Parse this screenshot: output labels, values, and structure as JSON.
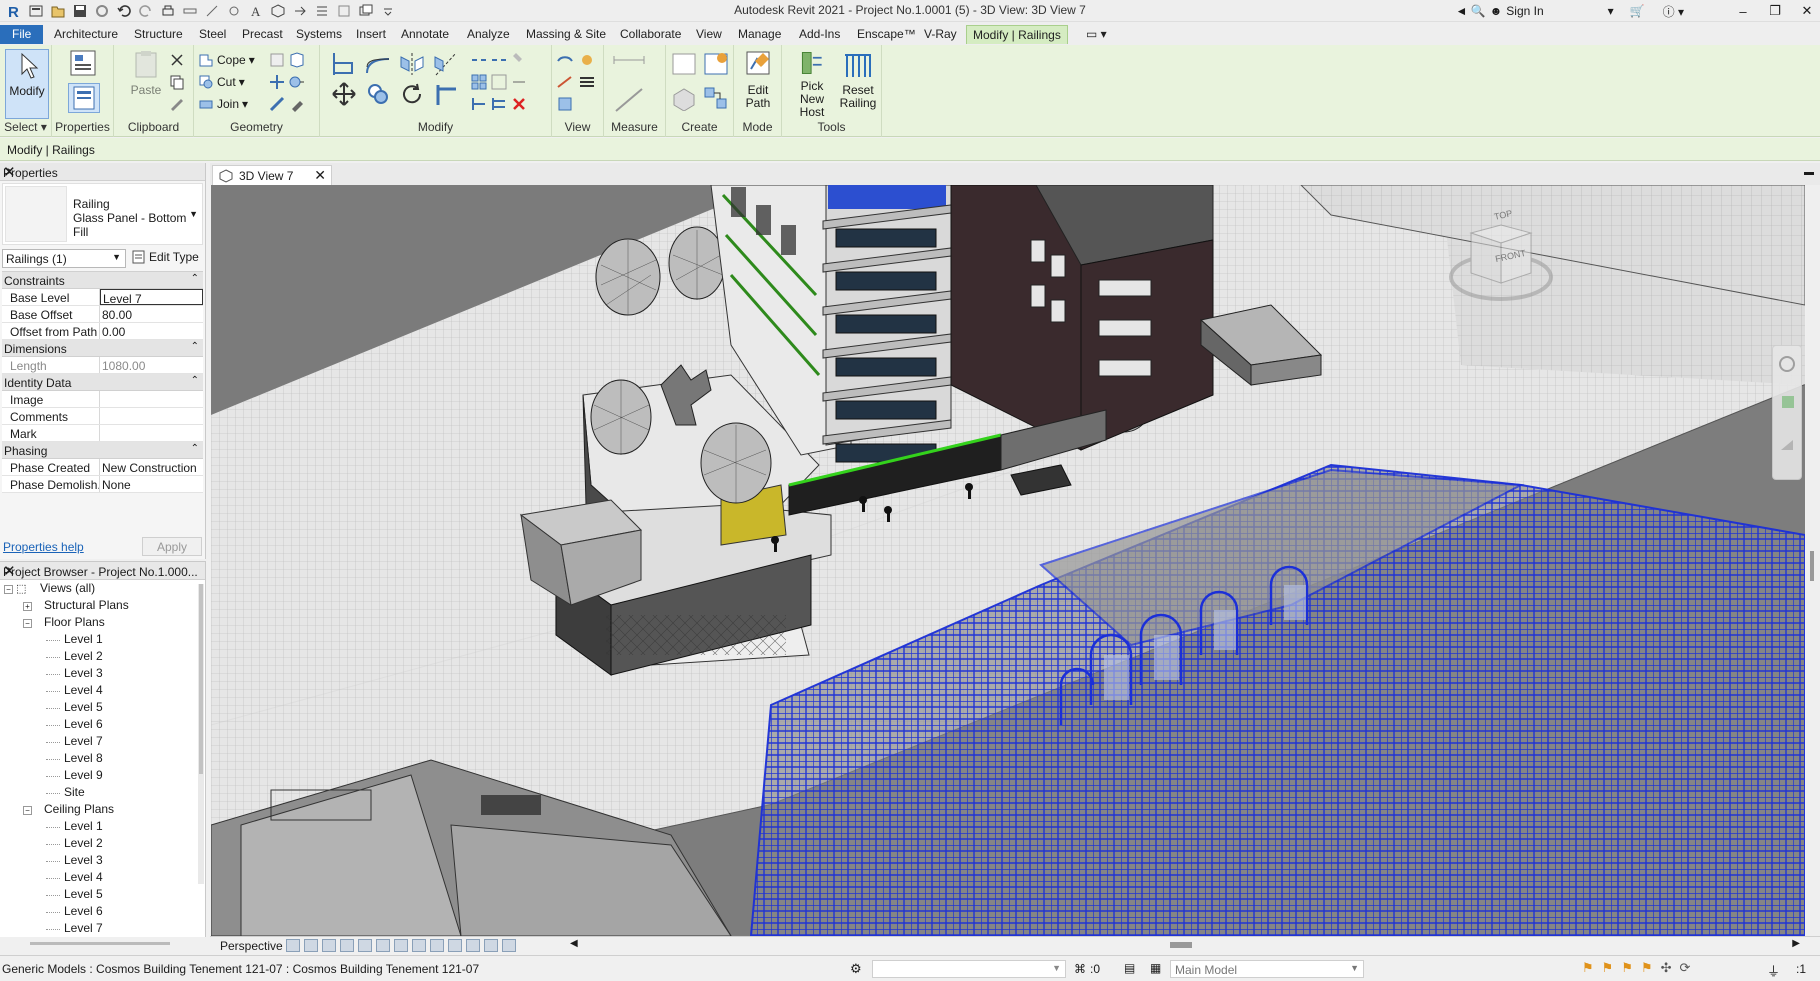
{
  "window": {
    "title": "Autodesk Revit 2021 - Project No.1.0001 (5) - 3D View: 3D View 7",
    "sign_in": "Sign In",
    "minimize": "–",
    "restore": "❐",
    "close": "✕"
  },
  "ribbon_tabs": [
    "File",
    "Architecture",
    "Structure",
    "Steel",
    "Precast",
    "Systems",
    "Insert",
    "Annotate",
    "Analyze",
    "Massing & Site",
    "Collaborate",
    "View",
    "Manage",
    "Add-Ins",
    "Enscape™",
    "V-Ray",
    "Modify | Railings"
  ],
  "ribbon": {
    "select": {
      "modify": "Modify",
      "label": "Select ▾"
    },
    "properties": {
      "label": "Properties"
    },
    "clipboard": {
      "paste": "Paste",
      "label": "Clipboard"
    },
    "geometry": {
      "cope": "Cope",
      "cut": "Cut",
      "join": "Join",
      "label": "Geometry"
    },
    "modify": {
      "label": "Modify"
    },
    "view": {
      "label": "View"
    },
    "measure": {
      "label": "Measure"
    },
    "create": {
      "label": "Create"
    },
    "mode": {
      "edit_path_1": "Edit",
      "edit_path_2": "Path",
      "label": "Mode"
    },
    "tools": {
      "pick_1": "Pick",
      "pick_2": "New Host",
      "reset_1": "Reset",
      "reset_2": "Railing",
      "label": "Tools"
    }
  },
  "context_bar": "Modify | Railings",
  "properties": {
    "header": "Properties",
    "type_family": "Railing",
    "type_name": "Glass Panel - Bottom Fill",
    "instance_selector": "Railings (1)",
    "edit_type": "Edit Type",
    "groups": {
      "constraints": "Constraints",
      "dimensions": "Dimensions",
      "identity": "Identity Data",
      "phasing": "Phasing"
    },
    "rows": {
      "base_level": {
        "name": "Base Level",
        "value": "Level 7"
      },
      "base_offset": {
        "name": "Base Offset",
        "value": "80.00"
      },
      "offset_path": {
        "name": "Offset from Path",
        "value": "0.00"
      },
      "length": {
        "name": "Length",
        "value": "1080.00"
      },
      "image": {
        "name": "Image",
        "value": ""
      },
      "comments": {
        "name": "Comments",
        "value": ""
      },
      "mark": {
        "name": "Mark",
        "value": ""
      },
      "phase_created": {
        "name": "Phase Created",
        "value": "New Construction"
      },
      "phase_demolished": {
        "name": "Phase Demolish...",
        "value": "None"
      }
    },
    "help": "Properties help",
    "apply": "Apply"
  },
  "browser": {
    "header": "Project Browser - Project No.1.000...",
    "views_all": "Views (all)",
    "structural_plans": "Structural Plans",
    "floor_plans": "Floor Plans",
    "floor_levels": [
      "Level 1",
      "Level 2",
      "Level 3",
      "Level 4",
      "Level 5",
      "Level 6",
      "Level 7",
      "Level 8",
      "Level 9",
      "Site"
    ],
    "ceiling_plans": "Ceiling Plans",
    "ceiling_levels": [
      "Level 1",
      "Level 2",
      "Level 3",
      "Level 4",
      "Level 5",
      "Level 6",
      "Level 7"
    ]
  },
  "view_tab": {
    "label": "3D View 7"
  },
  "viewcube": {
    "top": "TOP",
    "front": "FRONT"
  },
  "view_control": {
    "perspective": "Perspective"
  },
  "status": {
    "text": "Generic Models : Cosmos Building Tenement 121-07 : Cosmos Building Tenement 121-07",
    "zero": ":0",
    "model": "Main Model",
    "filter": ":1"
  }
}
